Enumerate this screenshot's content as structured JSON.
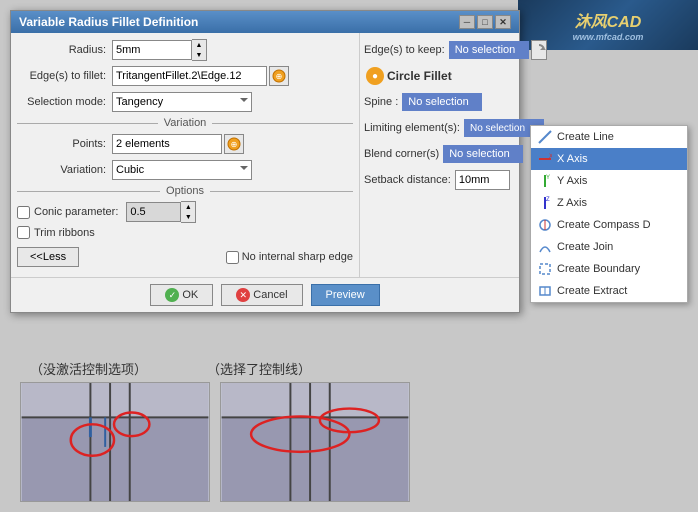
{
  "watermark": {
    "brand": "沐风CAD",
    "url": "www.mfcad.com"
  },
  "dialog": {
    "title": "Variable Radius Fillet Definition",
    "radius_label": "Radius:",
    "radius_value": "5mm",
    "edges_label": "Edge(s) to fillet:",
    "edges_value": "TritangentFillet.2\\Edge.12",
    "selection_mode_label": "Selection mode:",
    "selection_mode_value": "Tangency",
    "variation_label": "Variation",
    "points_label": "Points:",
    "points_value": "2 elements",
    "variation_field_label": "Variation:",
    "variation_value": "Cubic",
    "options_label": "Options",
    "conic_label": "Conic parameter:",
    "conic_value": "0.5",
    "trim_ribbons_label": "Trim ribbons",
    "less_btn": "<<Less",
    "no_internal_label": "No internal sharp edge",
    "edges_keep_label": "Edge(s) to keep:",
    "edges_keep_value": "No selection",
    "circle_fillet_label": "Circle Fillet",
    "spine_label": "Spine :",
    "spine_value": "No selection",
    "limiting_label": "Limiting element(s):",
    "limiting_value": "No selection",
    "blend_label": "Blend corner(s)",
    "blend_value": "No selection",
    "setback_label": "Setback distance:",
    "setback_value": "10mm",
    "ok_label": "OK",
    "cancel_label": "Cancel",
    "preview_label": "Preview",
    "selection_label": "No selection"
  },
  "context_menu": {
    "items": [
      {
        "label": "Create Line",
        "icon": "line",
        "highlighted": false
      },
      {
        "label": "X Axis",
        "icon": "x-axis",
        "highlighted": true
      },
      {
        "label": "Y Axis",
        "icon": "y-axis",
        "highlighted": false
      },
      {
        "label": "Z Axis",
        "icon": "z-axis",
        "highlighted": false
      },
      {
        "label": "Create Compass D",
        "icon": "compass",
        "highlighted": false
      },
      {
        "label": "Create Join",
        "icon": "join",
        "highlighted": false
      },
      {
        "label": "Create Boundary",
        "icon": "boundary",
        "highlighted": false
      },
      {
        "label": "Create Extract",
        "icon": "extract",
        "highlighted": false
      }
    ]
  },
  "bottom": {
    "label1": "（没激活控制选项）",
    "label2": "（选择了控制线）"
  }
}
